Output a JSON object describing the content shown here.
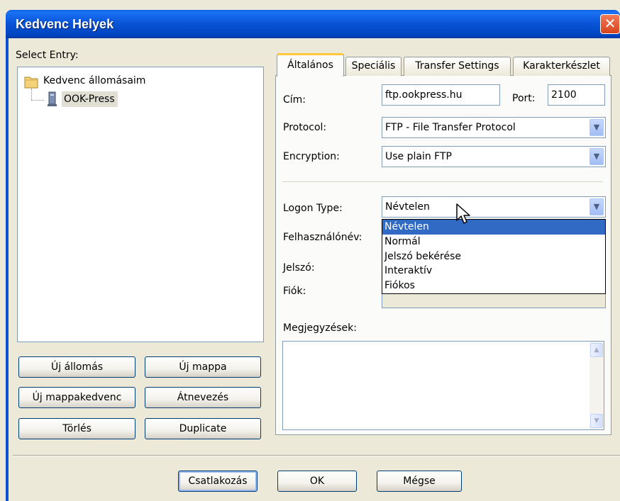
{
  "window": {
    "title": "Kedvenc Helyek",
    "close_label": "✕"
  },
  "left": {
    "select_entry_label": "Select Entry:",
    "tree": [
      {
        "label": "Kedvenc állomásaim",
        "icon": "folder-icon"
      },
      {
        "label": "OOK-Press",
        "icon": "server-icon"
      }
    ],
    "buttons": {
      "new_site": "Új állomás",
      "new_folder": "Új mappa",
      "new_bookmark": "Új mappakedvenc",
      "rename": "Átnevezés",
      "delete": "Törlés",
      "duplicate": "Duplicate"
    }
  },
  "tabs": [
    "Általános",
    "Speciális",
    "Transfer Settings",
    "Karakterkészlet"
  ],
  "general": {
    "host_label": "Cím:",
    "host_value": "ftp.ookpress.hu",
    "port_label": "Port:",
    "port_value": "2100",
    "protocol_label": "Protocol:",
    "protocol_value": "FTP - File Transfer Protocol",
    "encryption_label": "Encryption:",
    "encryption_value": "Use plain FTP",
    "logon_type_label": "Logon Type:",
    "logon_type_value": "Névtelen",
    "logon_type_options": [
      "Névtelen",
      "Normál",
      "Jelszó bekérése",
      "Interaktív",
      "Fiókos"
    ],
    "user_label": "Felhasználónév:",
    "password_label": "Jelszó:",
    "account_label": "Fiók:",
    "comments_label": "Megjegyzések:"
  },
  "footer": {
    "connect": "Csatlakozás",
    "ok": "OK",
    "cancel": "Mégse"
  },
  "colors": {
    "titlebar": "#0a56d8",
    "selection": "#316ac5",
    "tab_highlight": "#ffc83c",
    "window_bg": "#ece9d8"
  }
}
